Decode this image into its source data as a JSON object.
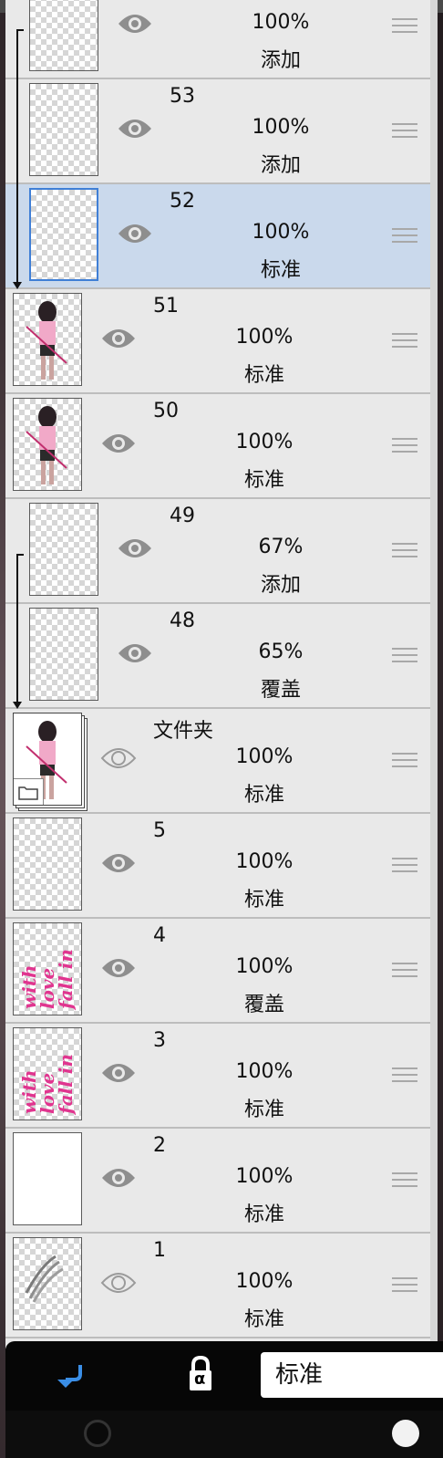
{
  "layers": [
    {
      "name": "",
      "opacity": "100%",
      "blend": "添加",
      "thumb": "blank",
      "clipped": true,
      "selected": false,
      "visible_icon": "eye-icon"
    },
    {
      "name": "53",
      "opacity": "100%",
      "blend": "添加",
      "thumb": "faint-blue-pink",
      "clipped": true,
      "selected": false,
      "visible_icon": "eye-icon"
    },
    {
      "name": "52",
      "opacity": "100%",
      "blend": "标准",
      "thumb": "blank",
      "clipped": true,
      "selected": true,
      "visible_icon": "eye-icon"
    },
    {
      "name": "51",
      "opacity": "100%",
      "blend": "标准",
      "thumb": "figure",
      "clipped": false,
      "selected": false,
      "visible_icon": "eye-icon"
    },
    {
      "name": "50",
      "opacity": "100%",
      "blend": "标准",
      "thumb": "figure",
      "clipped": false,
      "selected": false,
      "visible_icon": "eye-icon"
    },
    {
      "name": "49",
      "opacity": "67%",
      "blend": "添加",
      "thumb": "pink-light",
      "clipped": true,
      "selected": false,
      "visible_icon": "eye-icon"
    },
    {
      "name": "48",
      "opacity": "65%",
      "blend": "覆盖",
      "thumb": "pink-medium",
      "clipped": true,
      "selected": false,
      "visible_icon": "eye-icon"
    },
    {
      "name": "文件夹",
      "opacity": "100%",
      "blend": "标准",
      "thumb": "folder",
      "clipped": false,
      "selected": false,
      "visible_icon": "eye-outline-icon"
    },
    {
      "name": "5",
      "opacity": "100%",
      "blend": "标准",
      "thumb": "pink-strong",
      "clipped": false,
      "selected": false,
      "visible_icon": "eye-icon"
    },
    {
      "name": "4",
      "opacity": "100%",
      "blend": "覆盖",
      "thumb": "text-art",
      "clipped": false,
      "selected": false,
      "visible_icon": "eye-icon"
    },
    {
      "name": "3",
      "opacity": "100%",
      "blend": "标准",
      "thumb": "text-art",
      "clipped": false,
      "selected": false,
      "visible_icon": "eye-icon"
    },
    {
      "name": "2",
      "opacity": "100%",
      "blend": "标准",
      "thumb": "white",
      "clipped": false,
      "selected": false,
      "visible_icon": "eye-icon"
    },
    {
      "name": "1",
      "opacity": "100%",
      "blend": "标准",
      "thumb": "hair-sketch",
      "clipped": false,
      "selected": false,
      "visible_icon": "eye-outline-icon"
    }
  ],
  "thumb_art_text": {
    "line1": "fall in",
    "line2": "love",
    "line3": "with"
  },
  "toolbar": {
    "clip_icon": "clip-arrow-icon",
    "lock_icon": "alpha-lock-icon",
    "lock_label": "α",
    "blend_mode": "标准"
  },
  "colors": {
    "panel": "#e9e9e9",
    "selected_row": "#cad9ec",
    "selected_border": "#3f7fd6",
    "accent_pink": "#e0358f",
    "clip_icon_blue": "#3a8ee6"
  }
}
